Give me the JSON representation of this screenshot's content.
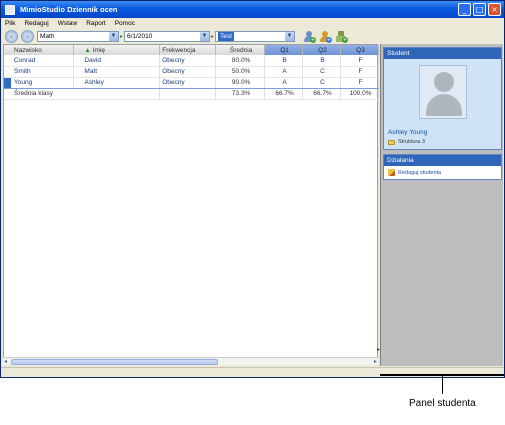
{
  "window": {
    "title": "MimioStudio Dziennik ocen",
    "buttons": [
      "_",
      "□",
      "×"
    ]
  },
  "menu": [
    "Plik",
    "Redaguj",
    "Wstaw",
    "Raport",
    "Pomoc"
  ],
  "toolbar": {
    "class_combo": "Math",
    "date_combo": "6/1/2010",
    "type_combo": "Test"
  },
  "grid": {
    "columns": [
      "Nazwisko",
      "Imię",
      "Frekwencja",
      "Średnia",
      "Q1",
      "Q2",
      "Q3"
    ],
    "rows": [
      {
        "last": "Conrad",
        "first": "David",
        "attendance": "Obecny",
        "avg": "80.0%",
        "q1": "B",
        "q2": "B",
        "q3": "F"
      },
      {
        "last": "Smith",
        "first": "Matt",
        "attendance": "Obecny",
        "avg": "50.0%",
        "q1": "A",
        "q2": "C",
        "q3": "F"
      },
      {
        "last": "Young",
        "first": "Ashley",
        "attendance": "Obecny",
        "avg": "90.0%",
        "q1": "A",
        "q2": "C",
        "q3": "F"
      }
    ],
    "summary": {
      "label": "Średnia klasy",
      "avg": "73.3%",
      "q1": "66.7%",
      "q2": "66.7%",
      "q3": "100.0%"
    }
  },
  "student_panel": {
    "header": "Student",
    "name": "Ashley Young",
    "file": "Struktura 3"
  },
  "actions_panel": {
    "header": "Działania",
    "edit_label": "Redaguj studenta"
  },
  "callout": {
    "label": "Panel studenta"
  }
}
